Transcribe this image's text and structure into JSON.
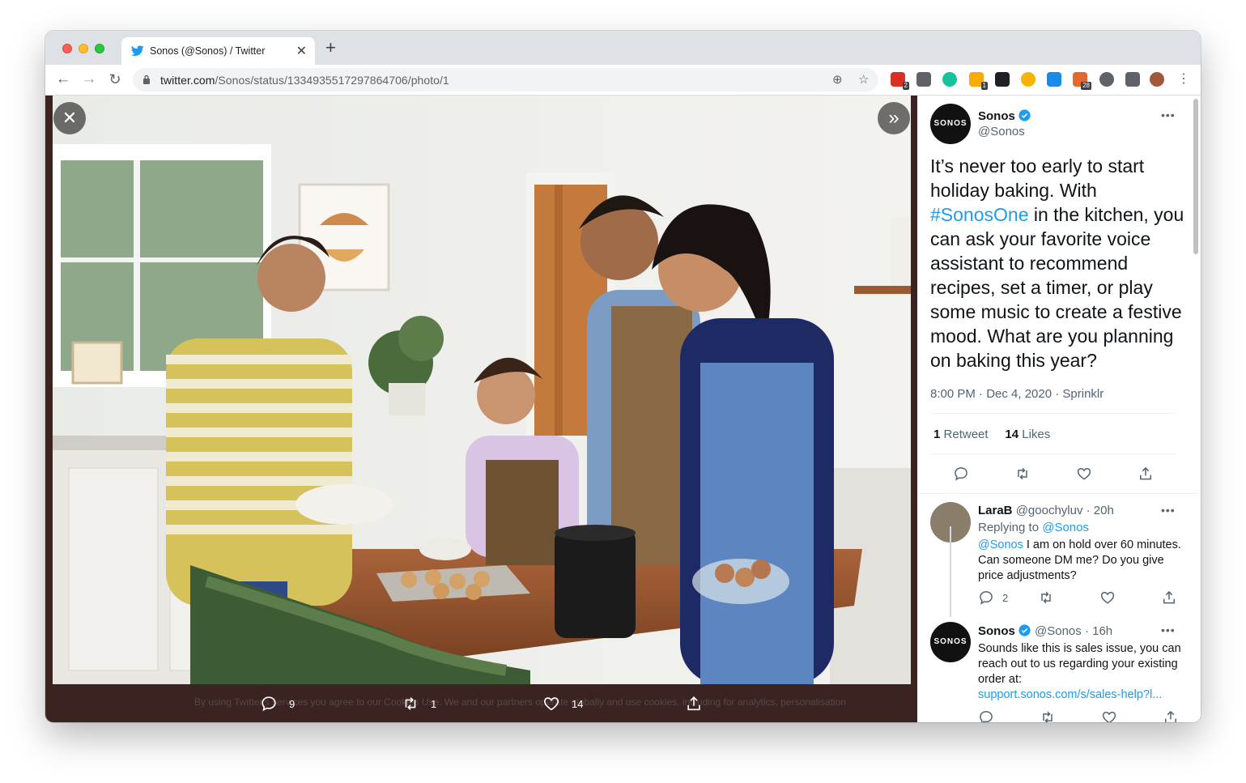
{
  "browser": {
    "tab_title": "Sonos (@Sonos) / Twitter",
    "url_host": "twitter.com",
    "url_path": "/Sonos/status/1334935517297864706/photo/1",
    "extensions": [
      {
        "name": "extension-1-icon",
        "color": "#d93025",
        "badge": "2"
      },
      {
        "name": "pocket-icon",
        "color": "#5f6368",
        "badge": ""
      },
      {
        "name": "grammarly-icon",
        "color": "#15c39a",
        "badge": ""
      },
      {
        "name": "extension-4-icon",
        "color": "#f9ab00",
        "badge": "1"
      },
      {
        "name": "extension-5-icon",
        "color": "#202124",
        "badge": ""
      },
      {
        "name": "extension-6-icon",
        "color": "#f4b400",
        "badge": ""
      },
      {
        "name": "skype-icon",
        "color": "#1a8ae5",
        "badge": ""
      },
      {
        "name": "extension-8-icon",
        "color": "#e06a2b",
        "badge": "28"
      },
      {
        "name": "cloud-icon",
        "color": "#5f6368",
        "badge": ""
      },
      {
        "name": "puzzle-icon",
        "color": "#5f6368",
        "badge": ""
      }
    ]
  },
  "media": {
    "reply_count": "9",
    "retweet_count": "1",
    "like_count": "14",
    "cookie_text": "By using Twitter's services you agree to our Cookies Use. We and our partners operate globally and use cookies, including for analytics, personalisation"
  },
  "tweet": {
    "author_name": "Sonos",
    "author_handle": "@Sonos",
    "avatar_text": "SONOS",
    "text_before": "It’s never too early to start holiday baking. With ",
    "hashtag": "#SonosOne",
    "text_after": " in the kitchen, you can ask your favorite voice assistant to recommend recipes, set a timer, or play some music to create a festive mood. What are you planning on baking this year?",
    "meta": "8:00 PM · Dec 4, 2020 · Sprinklr",
    "retweets_count": "1",
    "retweets_label": "Retweet",
    "likes_count": "14",
    "likes_label": "Likes"
  },
  "replies": [
    {
      "name": "LaraB",
      "handle_time": "@goochyluv · 20h",
      "replying_prefix": "Replying to ",
      "replying_to": "@Sonos",
      "mention": "@Sonos",
      "text": " I am on hold over 60 minutes. Can someone DM me? Do you give price adjustments?",
      "reply_count": "2"
    },
    {
      "name": "Sonos",
      "handle_time": "@Sonos · 16h",
      "avatar_text": "SONOS",
      "text": "Sounds like this is sales issue, you can reach out to us regarding your existing order at:",
      "link": "support.sonos.com/s/sales-help?l..."
    }
  ],
  "colors": {
    "accent": "#1d9bf0",
    "media_bg": "#3a2321"
  }
}
